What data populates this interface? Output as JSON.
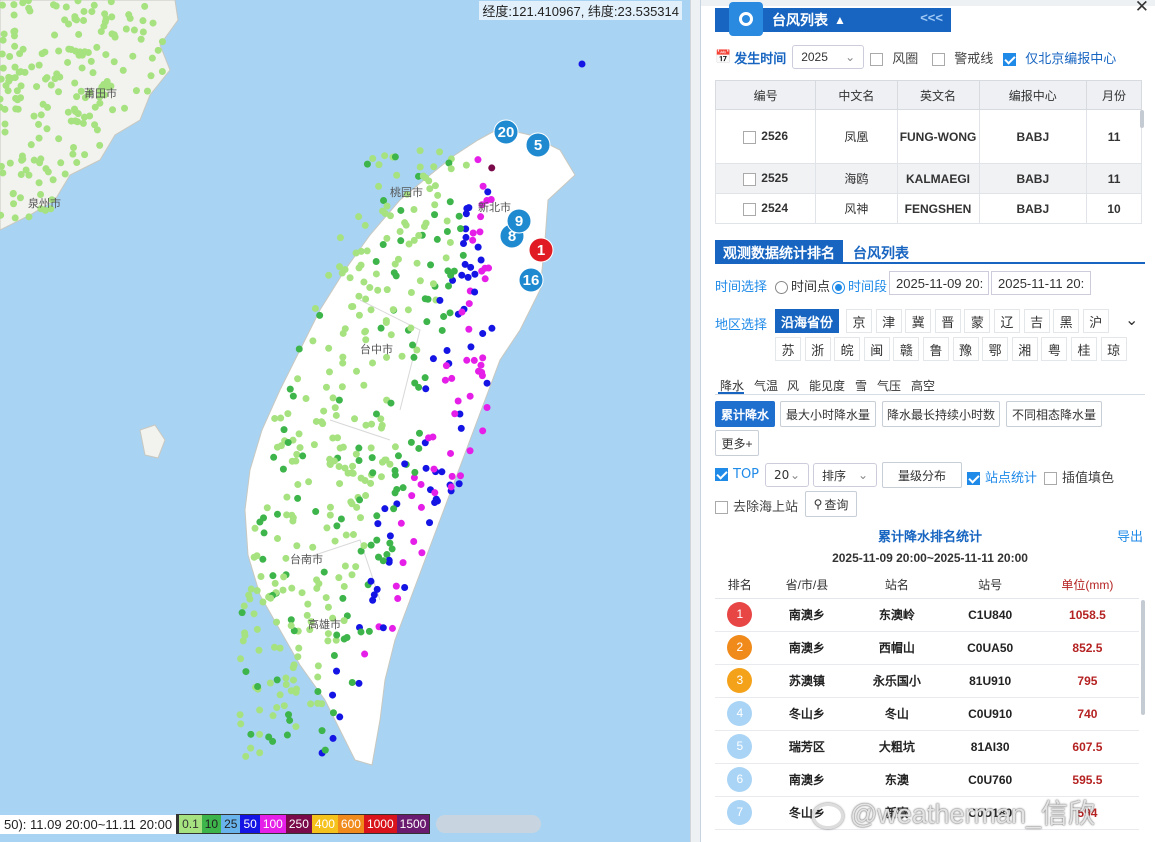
{
  "map": {
    "coord_text": "经度:121.410967, 纬度:23.535314",
    "cities": [
      "莆田市",
      "泉州市",
      "桃园市",
      "新北市",
      "台中市",
      "台南市",
      "高雄市"
    ],
    "markers": [
      "20",
      "5",
      "1",
      "8",
      "9",
      "16"
    ],
    "legend_label": "50): 11.09 20:00~11.11 20:00",
    "legend": [
      {
        "label": "0.1",
        "color": "#a6e27f"
      },
      {
        "label": "10",
        "color": "#3db54a"
      },
      {
        "label": "25",
        "color": "#68b3ec"
      },
      {
        "label": "50",
        "color": "#1414e4"
      },
      {
        "label": "100",
        "color": "#e51ee8"
      },
      {
        "label": "250",
        "color": "#7a0a4a"
      },
      {
        "label": "400",
        "color": "#f5c21b"
      },
      {
        "label": "600",
        "color": "#f08a1a"
      },
      {
        "label": "1000",
        "color": "#d8131c"
      },
      {
        "label": "1500",
        "color": "#6a1a6f"
      }
    ]
  },
  "panel": {
    "title": "台风列表",
    "collapse": "<<<",
    "occur_time_label": "发生时间",
    "year": "2025",
    "wind_circle": "风圈",
    "warn_line": "警戒线",
    "only_beijing": "仅北京编报中心",
    "typhoon_headers": [
      "编号",
      "中文名",
      "英文名",
      "编报中心",
      "月份"
    ],
    "typhoons": [
      {
        "id": "2526",
        "cn": "凤凰",
        "en": "FUNG-WONG",
        "center": "BABJ",
        "month": "11"
      },
      {
        "id": "2525",
        "cn": "海鸥",
        "en": "KALMAEGI",
        "center": "BABJ",
        "month": "11"
      },
      {
        "id": "2524",
        "cn": "风神",
        "en": "FENGSHEN",
        "center": "BABJ",
        "month": "10"
      }
    ],
    "tab_stats": "观测数据统计排名",
    "tab_list": "台风列表",
    "time_select": "时间选择",
    "time_point": "时间点",
    "time_range": "时间段",
    "time_start": "2025-11-09 20:",
    "time_end": "2025-11-11 20:",
    "region_select": "地区选择",
    "coastal": "沿海省份",
    "provinces_row1": [
      "京",
      "津",
      "冀",
      "晋",
      "蒙",
      "辽",
      "吉",
      "黑",
      "沪"
    ],
    "provinces_row2": [
      "苏",
      "浙",
      "皖",
      "闽",
      "赣",
      "鲁",
      "豫",
      "鄂",
      "湘",
      "粤",
      "桂",
      "琼"
    ],
    "element_tabs": [
      "降水",
      "气温",
      "风",
      "能见度",
      "雪",
      "气压",
      "高空"
    ],
    "buttons": [
      "累计降水",
      "最大小时降水量",
      "降水最长持续小时数",
      "不同相态降水量",
      "更多+"
    ],
    "top_label": "TOP",
    "top_value": "20",
    "sort_label": "排序",
    "grade_dist": "量级分布",
    "station_stat": "站点统计",
    "interp_fill": "插值填色",
    "remove_sea": "去除海上站",
    "query": "查询",
    "stat_title": "累计降水排名统计",
    "export": "导出",
    "stat_range": "2025-11-09 20:00~2025-11-11 20:00",
    "rank_headers": [
      "排名",
      "省/市/县",
      "站名",
      "站号",
      "单位(mm)"
    ],
    "ranks": [
      {
        "rank": "1",
        "county": "南澳乡",
        "name": "东澳岭",
        "code": "C1U840",
        "val": "1058.5",
        "color": "#e84545"
      },
      {
        "rank": "2",
        "county": "南澳乡",
        "name": "西帽山",
        "code": "C0UA50",
        "val": "852.5",
        "color": "#f08a1a"
      },
      {
        "rank": "3",
        "county": "苏澳镇",
        "name": "永乐国小",
        "code": "81U910",
        "val": "795",
        "color": "#f5a21b"
      },
      {
        "rank": "4",
        "county": "冬山乡",
        "name": "冬山",
        "code": "C0U910",
        "val": "740",
        "color": "#a9d4f5"
      },
      {
        "rank": "5",
        "county": "瑞芳区",
        "name": "大粗坑",
        "code": "81AI30",
        "val": "607.5",
        "color": "#a9d4f5"
      },
      {
        "rank": "6",
        "county": "南澳乡",
        "name": "东澳",
        "code": "C0U760",
        "val": "595.5",
        "color": "#a9d4f5"
      },
      {
        "rank": "7",
        "county": "冬山乡",
        "name": "新寮",
        "code": "C0U180",
        "val": "594",
        "color": "#a9d4f5"
      }
    ]
  },
  "watermark": "@weatherman_信欣"
}
